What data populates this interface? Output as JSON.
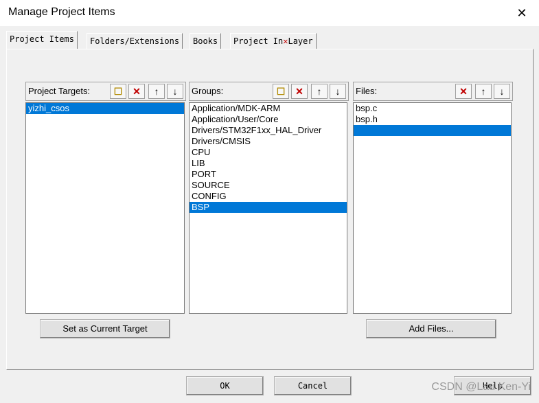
{
  "window": {
    "title": "Manage Project Items",
    "close_glyph": "✕"
  },
  "tabs": [
    {
      "label": "Project Items",
      "active": true
    },
    {
      "label": "Folders/Extensions"
    },
    {
      "label": "Books"
    },
    {
      "label": "Project In"
    },
    {
      "label": "Layer"
    }
  ],
  "targets": {
    "title": "Project Targets:",
    "items": [
      "yizhi_csos"
    ],
    "selected_index": 0,
    "set_current_label": "Set as Current Target"
  },
  "groups": {
    "title": "Groups:",
    "items": [
      "Application/MDK-ARM",
      "Application/User/Core",
      "Drivers/STM32F1xx_HAL_Driver",
      "Drivers/CMSIS",
      "CPU",
      "LIB",
      "PORT",
      "SOURCE",
      "CONFIG",
      "BSP"
    ],
    "selected_index": 9
  },
  "files": {
    "title": "Files:",
    "items": [
      "bsp.c",
      "bsp.h"
    ],
    "add_files_label": "Add Files..."
  },
  "buttons": {
    "ok": "OK",
    "cancel": "Cancel",
    "help": "Help"
  },
  "watermark": "CSDN @Lau Ken-Yi",
  "colors": {
    "selection": "#0078d7",
    "delete_icon": "#c00000"
  }
}
